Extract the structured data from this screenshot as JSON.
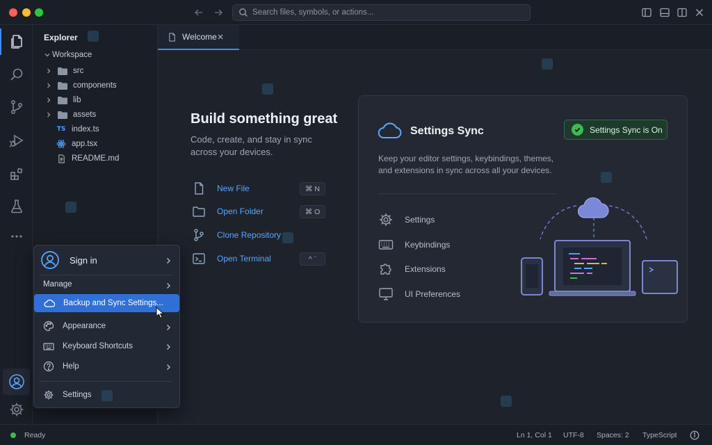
{
  "search": {
    "placeholder": "Search files, symbols, or actions..."
  },
  "sidebar": {
    "title": "Explorer",
    "workspace": "Workspace",
    "items": [
      {
        "type": "folder",
        "label": "src"
      },
      {
        "type": "folder",
        "label": "components"
      },
      {
        "type": "folder",
        "label": "lib"
      },
      {
        "type": "folder",
        "label": "assets"
      },
      {
        "type": "ts",
        "label": "index.ts",
        "badge": "TS"
      },
      {
        "type": "react",
        "label": "app.tsx"
      },
      {
        "type": "file",
        "label": "README.md"
      }
    ]
  },
  "tabs": [
    {
      "label": "Welcome"
    }
  ],
  "welcome": {
    "title": "Build something great",
    "subtitle": "Code, create, and stay in sync across your devices.",
    "actions": [
      {
        "icon": "new-file-icon",
        "label": "New File",
        "shortcut": "⌘ N"
      },
      {
        "icon": "folder-icon",
        "label": "Open Folder",
        "shortcut": "⌘ O"
      },
      {
        "icon": "git-branch-icon",
        "label": "Clone Repository",
        "shortcut": ""
      },
      {
        "icon": "terminal-icon",
        "label": "Open Terminal",
        "shortcut": "^ `"
      }
    ]
  },
  "sync_card": {
    "title": "Settings Sync",
    "status": "Settings Sync is On",
    "description": "Keep your editor settings, keybindings, themes, and extensions in sync across all your devices.",
    "items": [
      {
        "icon": "gear-icon",
        "label": "Settings"
      },
      {
        "icon": "keyboard-icon",
        "label": "Keybindings"
      },
      {
        "icon": "puzzle-icon",
        "label": "Extensions"
      },
      {
        "icon": "monitor-icon",
        "label": "UI Preferences"
      }
    ],
    "accent": "#3fb950"
  },
  "account_menu": {
    "signin": "Sign in",
    "manage": "Manage",
    "items": [
      {
        "icon": "cloud-icon",
        "label": "Backup and Sync Settings...",
        "highlighted": true
      },
      {
        "icon": "palette-icon",
        "label": "Appearance"
      },
      {
        "icon": "keyboard-icon",
        "label": "Keyboard Shortcuts"
      },
      {
        "icon": "help-icon",
        "label": "Help"
      },
      {
        "icon": "gear-icon",
        "label": "Settings"
      }
    ],
    "highlight_color": "#2f6fd6"
  },
  "statusbar": {
    "state": "Ready",
    "position": "Ln 1, Col 1",
    "encoding": "UTF-8",
    "indent": "Spaces: 2",
    "language": "TypeScript"
  }
}
